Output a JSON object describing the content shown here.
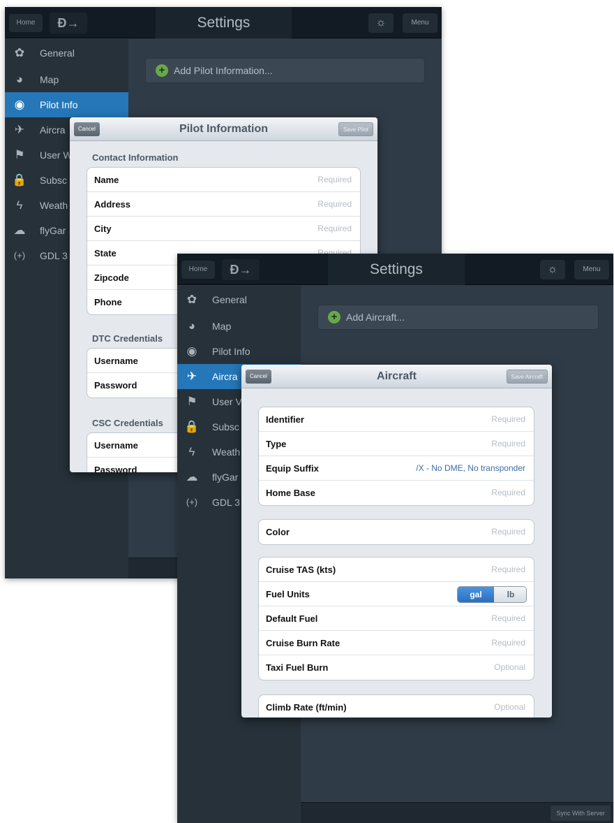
{
  "screen1": {
    "topbar": {
      "home": "Home",
      "direct_to": "Đ→",
      "title": "Settings",
      "brightness": "☼",
      "menu": "Menu"
    },
    "sidebar": [
      {
        "label": "General",
        "icon": "gear-icon",
        "glyph": "✿"
      },
      {
        "label": "Map",
        "icon": "globe-icon",
        "glyph": "◕"
      },
      {
        "label": "Pilot Info",
        "icon": "pilot-icon",
        "glyph": "◉"
      },
      {
        "label": "Aircra",
        "icon": "airplane-icon",
        "glyph": "✈"
      },
      {
        "label": "User W",
        "icon": "flag-icon",
        "glyph": "⚑"
      },
      {
        "label": "Subsc",
        "icon": "lock-icon",
        "glyph": "🔒"
      },
      {
        "label": "Weath",
        "icon": "weather-icon",
        "glyph": "ϟ"
      },
      {
        "label": "flyGar",
        "icon": "cloud-icon",
        "glyph": "☁"
      },
      {
        "label": "GDL 3",
        "icon": "wireless-icon",
        "glyph": "(+)"
      }
    ],
    "add_button": "Add Pilot Information...",
    "modal": {
      "title": "Pilot Information",
      "cancel": "Cancel",
      "save": "Save Pilot",
      "contact_header": "Contact Information",
      "contact_rows": [
        {
          "label": "Name",
          "value": "Required"
        },
        {
          "label": "Address",
          "value": "Required"
        },
        {
          "label": "City",
          "value": "Required"
        },
        {
          "label": "State",
          "value": "Required"
        },
        {
          "label": "Zipcode",
          "value": ""
        },
        {
          "label": "Phone",
          "value": ""
        }
      ],
      "dtc_header": "DTC Credentials",
      "dtc_rows": [
        {
          "label": "Username"
        },
        {
          "label": "Password"
        }
      ],
      "csc_header": "CSC Credentials",
      "csc_rows": [
        {
          "label": "Username"
        },
        {
          "label": "Password"
        }
      ]
    }
  },
  "screen2": {
    "topbar": {
      "home": "Home",
      "direct_to": "Đ→",
      "title": "Settings",
      "brightness": "☼",
      "menu": "Menu"
    },
    "sidebar": [
      {
        "label": "General",
        "icon": "gear-icon",
        "glyph": "✿"
      },
      {
        "label": "Map",
        "icon": "globe-icon",
        "glyph": "◕"
      },
      {
        "label": "Pilot Info",
        "icon": "pilot-icon",
        "glyph": "◉"
      },
      {
        "label": "Aircra",
        "icon": "airplane-icon",
        "glyph": "✈"
      },
      {
        "label": "User V",
        "icon": "flag-icon",
        "glyph": "⚑"
      },
      {
        "label": "Subsc",
        "icon": "lock-icon",
        "glyph": "🔒"
      },
      {
        "label": "Weath",
        "icon": "weather-icon",
        "glyph": "ϟ"
      },
      {
        "label": "flyGar",
        "icon": "cloud-icon",
        "glyph": "☁"
      },
      {
        "label": "GDL 3",
        "icon": "wireless-icon",
        "glyph": "(+)"
      }
    ],
    "add_button": "Add Aircraft...",
    "sync": "Sync With Server",
    "modal": {
      "title": "Aircraft",
      "cancel": "Cancel",
      "save": "Save Aircraft",
      "group1": [
        {
          "label": "Identifier",
          "value": "Required"
        },
        {
          "label": "Type",
          "value": "Required"
        },
        {
          "label": "Equip Suffix",
          "value": "/X - No DME, No transponder"
        },
        {
          "label": "Home Base",
          "value": "Required"
        }
      ],
      "group2": [
        {
          "label": "Color",
          "value": "Required"
        }
      ],
      "group3": [
        {
          "label": "Cruise TAS (kts)",
          "value": "Required"
        },
        {
          "label": "Fuel Units",
          "seg_on": "gal",
          "seg_off": "lb"
        },
        {
          "label": "Default Fuel",
          "value": "Required"
        },
        {
          "label": "Cruise Burn Rate",
          "value": "Required"
        },
        {
          "label": "Taxi Fuel Burn",
          "value": "Optional"
        }
      ],
      "group4": [
        {
          "label": "Climb Rate (ft/min)",
          "value": "Optional"
        }
      ]
    }
  }
}
